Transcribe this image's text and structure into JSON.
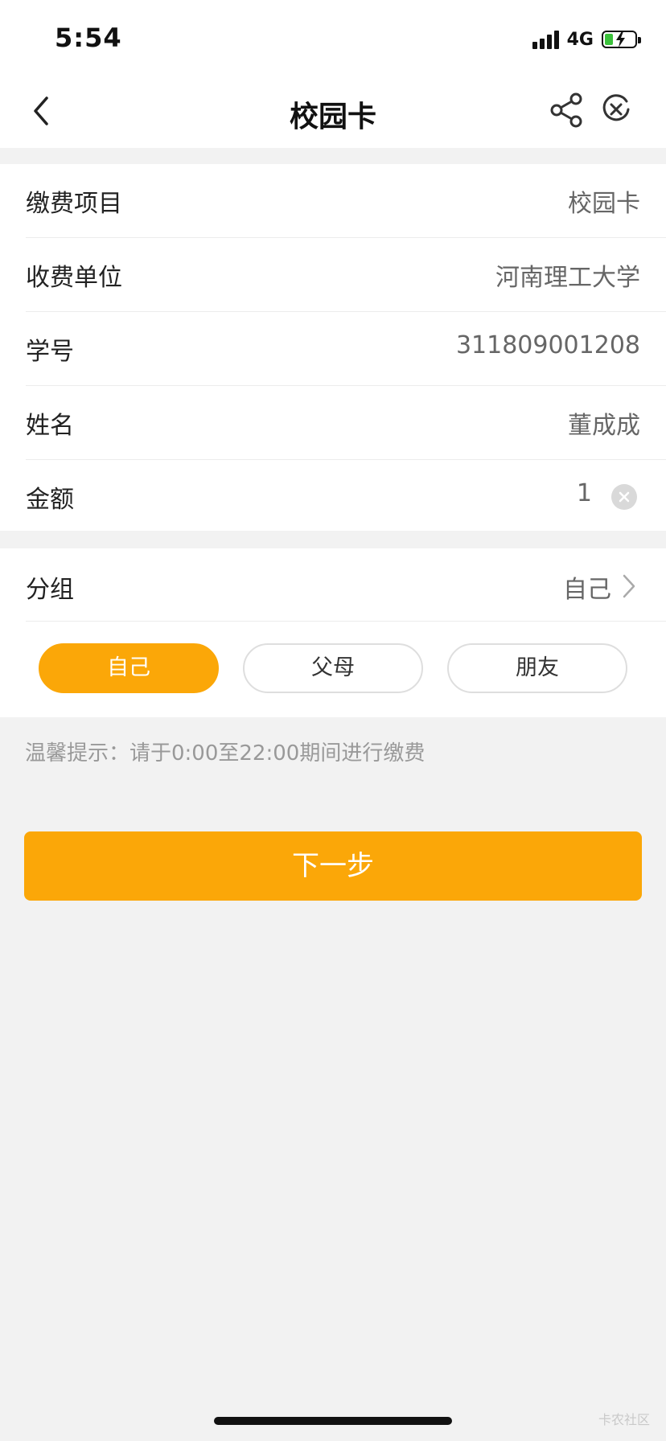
{
  "status_bar": {
    "time": "5:54",
    "network": "4G"
  },
  "nav": {
    "title": "校园卡",
    "back_icon": "chevron-left-icon",
    "share_icon": "share-icon",
    "close_icon": "close-circle-icon"
  },
  "form": {
    "rows": [
      {
        "label": "缴费项目",
        "value": "校园卡"
      },
      {
        "label": "收费单位",
        "value": "河南理工大学"
      },
      {
        "label": "学号",
        "value": "311809001208"
      },
      {
        "label": "姓名",
        "value": "董成成"
      },
      {
        "label": "金额",
        "value": "1"
      }
    ]
  },
  "group": {
    "label": "分组",
    "value": "自己",
    "options": [
      "自己",
      "父母",
      "朋友"
    ],
    "selected_index": 0
  },
  "tip": "温馨提示：请于0:00至22:00期间进行缴费",
  "next_button": "下一步",
  "watermark": "卡农社区",
  "colors": {
    "accent": "#fba708",
    "background": "#f2f2f2",
    "battery": "#3bc13b"
  }
}
